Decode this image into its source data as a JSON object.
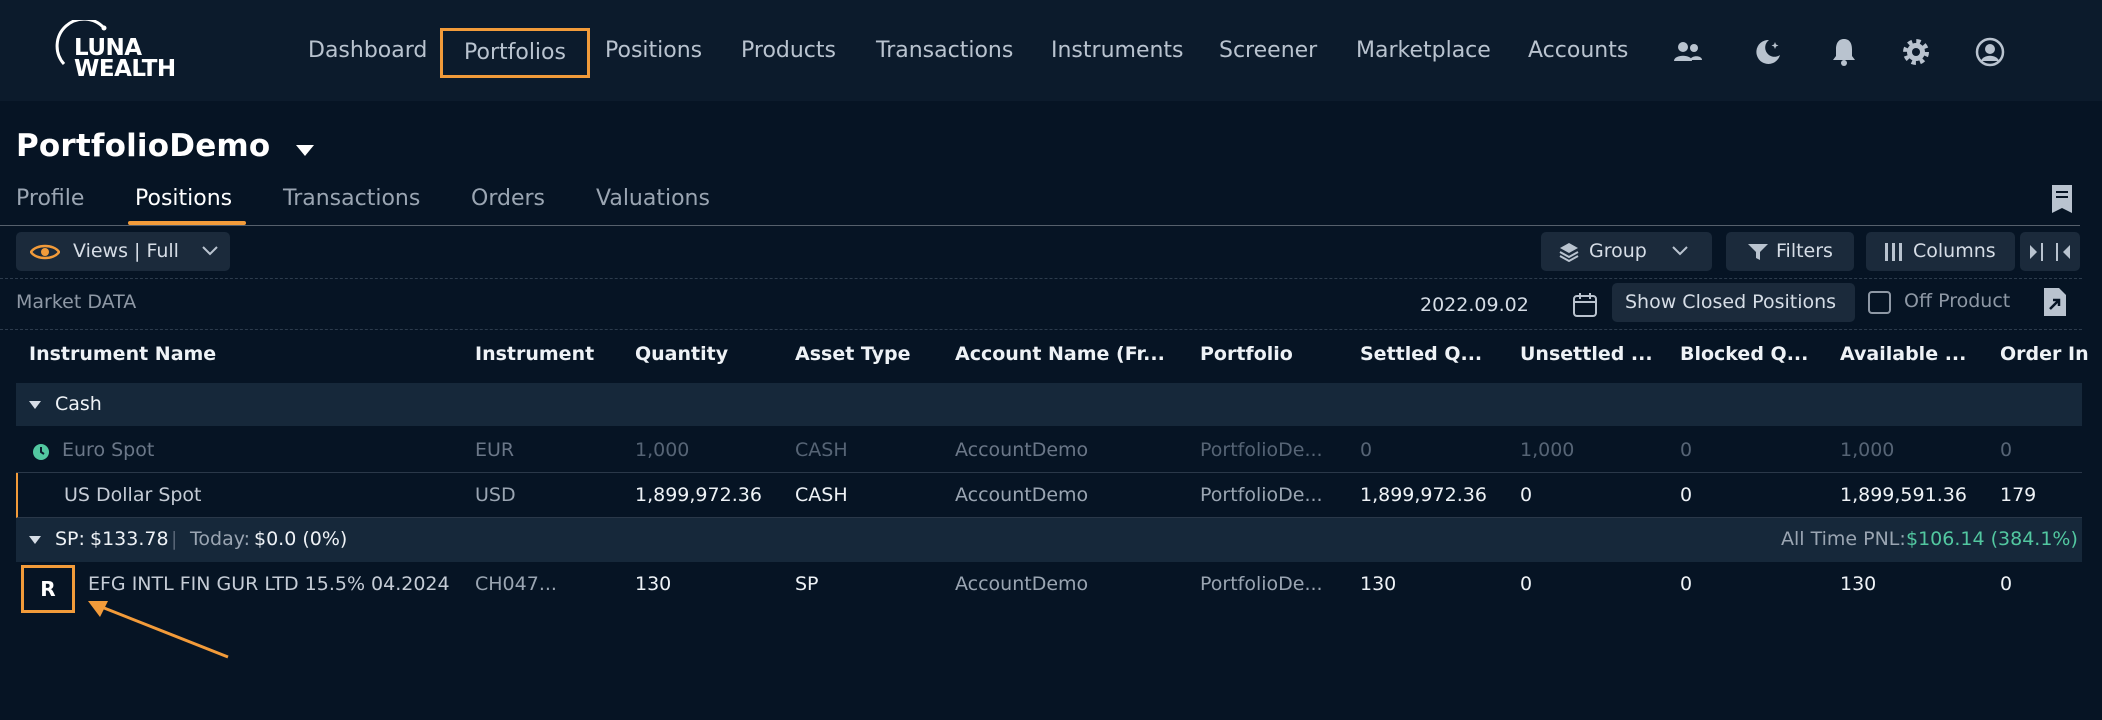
{
  "logo": {
    "line1": "LUNA",
    "line2": "WEALTH"
  },
  "nav": {
    "items": [
      "Dashboard",
      "Portfolios",
      "Positions",
      "Products",
      "Transactions",
      "Instruments",
      "Screener",
      "Marketplace",
      "Accounts"
    ],
    "highlighted": "Portfolios",
    "icons": [
      "users-icon",
      "moon-icon",
      "bell-icon",
      "gear-icon",
      "user-circle-icon"
    ]
  },
  "page": {
    "title": "PortfolioDemo"
  },
  "tabs": {
    "items": [
      "Profile",
      "Positions",
      "Transactions",
      "Orders",
      "Valuations"
    ],
    "active": "Positions"
  },
  "toolbar": {
    "views_label": "Views | Full",
    "group_label": "Group",
    "filters_label": "Filters",
    "columns_label": "Columns"
  },
  "market": {
    "label": "Market DATA",
    "date": "2022.09.02",
    "show_closed_label": "Show Closed Positions",
    "off_product_label": "Off Product"
  },
  "table": {
    "headers": [
      "Instrument Name",
      "Instrument",
      "Quantity",
      "Asset Type",
      "Account Name (Fr...",
      "Portfolio",
      "Settled Q...",
      "Unsettled ...",
      "Blocked Q...",
      "Available ...",
      "Order In"
    ],
    "cash_group": {
      "label": "Cash"
    },
    "rows_cash": [
      {
        "name": "Euro Spot",
        "instrument": "EUR",
        "quantity": "1,000",
        "asset_type": "CASH",
        "account": "AccountDemo",
        "portfolio": "PortfolioDe...",
        "settled": "0",
        "unsettled": "1,000",
        "blocked": "0",
        "available": "1,000",
        "order": "0"
      },
      {
        "name": "US Dollar Spot",
        "instrument": "USD",
        "quantity": "1,899,972.36",
        "asset_type": "CASH",
        "account": "AccountDemo",
        "portfolio": "PortfolioDe...",
        "settled": "1,899,972.36",
        "unsettled": "0",
        "blocked": "0",
        "available": "1,899,591.36",
        "order": "179"
      }
    ],
    "sp_group": {
      "label_prefix": "SP:",
      "value": "$133.78",
      "separator": "|",
      "today_label": "Today:",
      "today_value": "$0.0 (0%)",
      "pnl_label": "All Time PNL:",
      "pnl_value": "$106.14 (384.1%)"
    },
    "rows_sp": [
      {
        "badge": "R",
        "name": "EFG INTL FIN GUR LTD 15.5% 04.2024",
        "instrument": "CH047...",
        "quantity": "130",
        "asset_type": "SP",
        "account": "AccountDemo",
        "portfolio": "PortfolioDe...",
        "settled": "130",
        "unsettled": "0",
        "blocked": "0",
        "available": "130",
        "order": "0"
      }
    ]
  },
  "colors": {
    "accent": "#f29b3a",
    "background": "#061424",
    "topbar": "#0c1b2c",
    "positive": "#52c7a0"
  }
}
